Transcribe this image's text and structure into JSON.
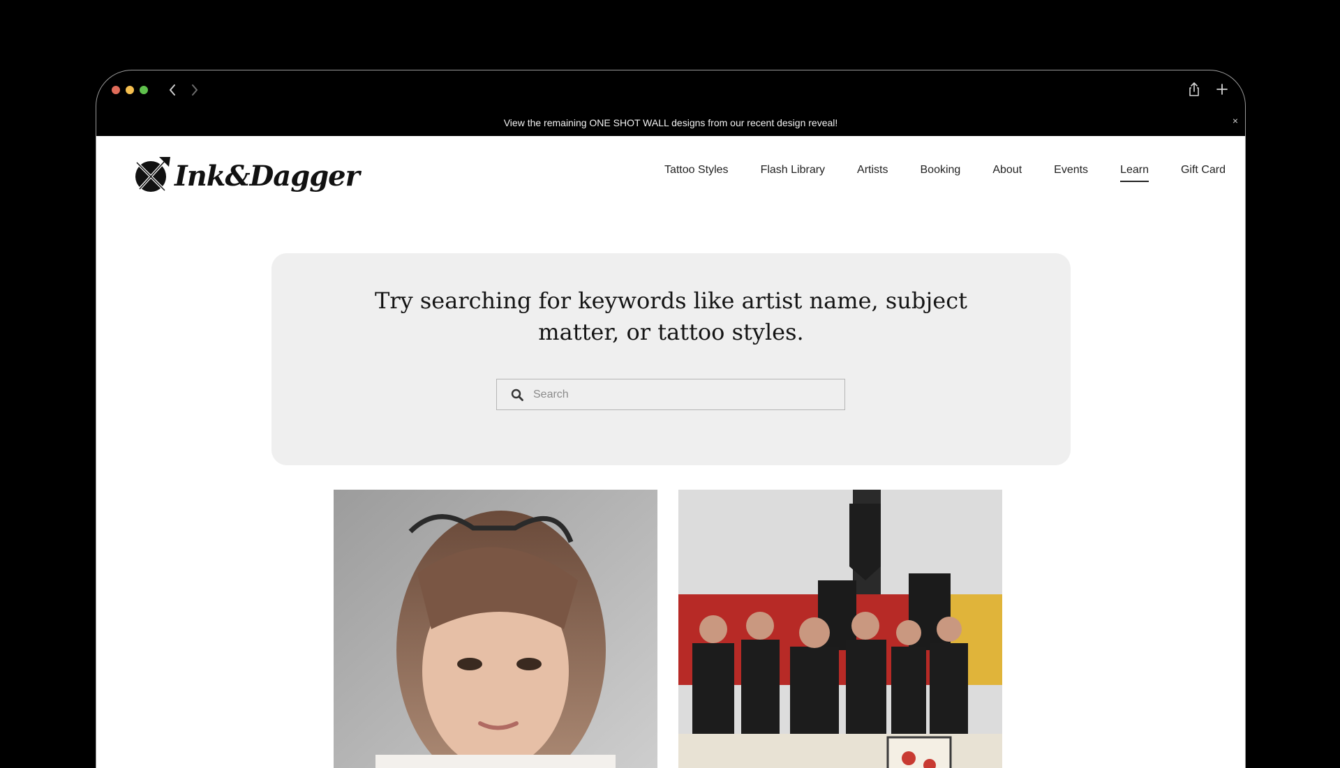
{
  "window": {
    "traffic_lights": {
      "red": "#e06c5a",
      "yellow": "#f5bf4f",
      "green": "#5fc04c"
    },
    "icons": {
      "back": "chevron-left-icon",
      "forward": "chevron-right-icon",
      "share": "share-icon",
      "new_tab": "plus-icon"
    }
  },
  "announcement": {
    "text": "View the remaining ONE SHOT WALL designs from our recent design reveal!",
    "close_label": "×"
  },
  "header": {
    "logo_text": "Ink&Dagger",
    "nav": [
      {
        "label": "Tattoo Styles"
      },
      {
        "label": "Flash Library"
      },
      {
        "label": "Artists"
      },
      {
        "label": "Booking"
      },
      {
        "label": "About"
      },
      {
        "label": "Events"
      },
      {
        "label": "Learn",
        "active": true
      },
      {
        "label": "Gift Card"
      }
    ]
  },
  "search_section": {
    "headline_line1": "Try searching for keywords like artist name, subject",
    "headline_line2": "matter, or tattoo styles.",
    "placeholder": "Search",
    "icon": "search-icon"
  },
  "colors": {
    "announcement_bg": "#000000",
    "search_card_bg": "#efefef",
    "page_bg": "#ffffff"
  }
}
